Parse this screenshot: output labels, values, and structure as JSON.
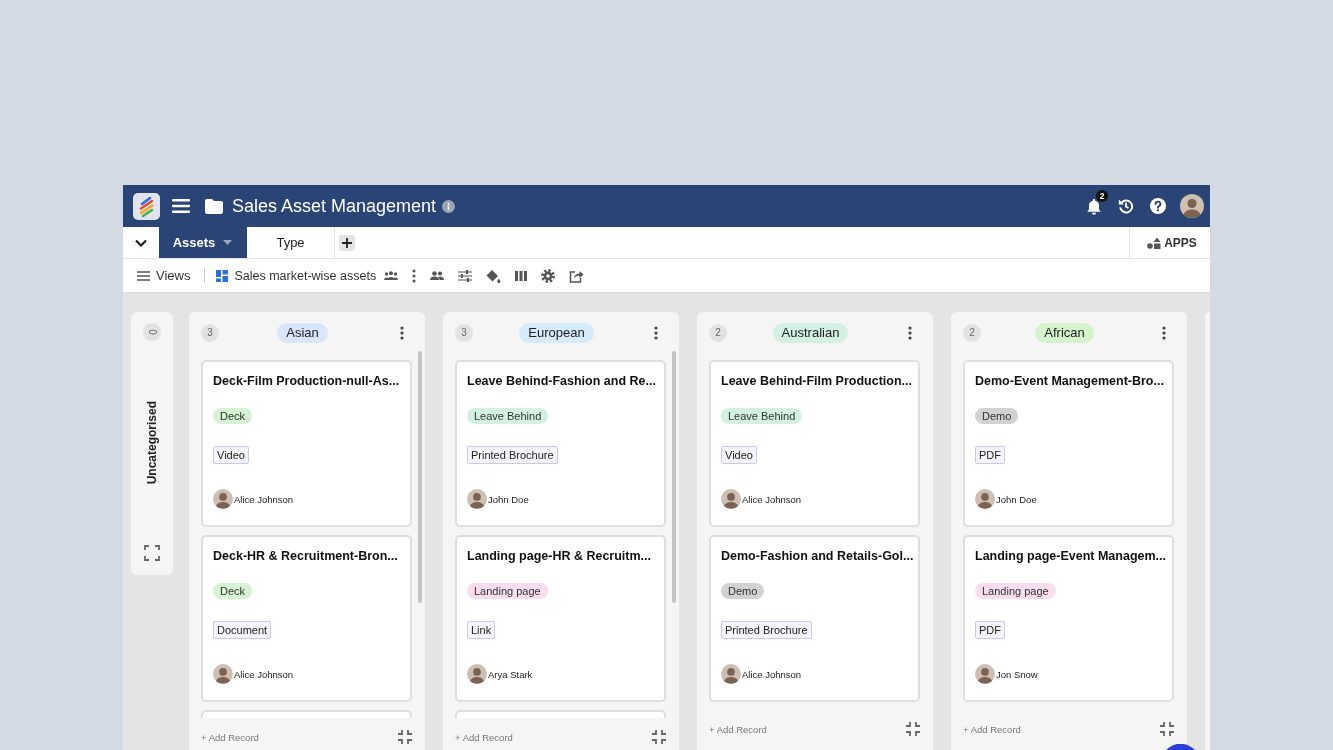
{
  "header": {
    "title": "Sales Asset Management",
    "notifications": "2"
  },
  "tabs": [
    {
      "label": "Assets",
      "selected": true
    },
    {
      "label": "Type",
      "selected": false
    }
  ],
  "apps_label": "APPS",
  "toolbar": {
    "views_label": "Views",
    "view_name": "Sales market-wise assets"
  },
  "board": {
    "uncategorised": {
      "label": "Uncategorised",
      "count": "0"
    },
    "columns": [
      {
        "kind": "group",
        "label": "Asian",
        "count": "3",
        "color": "#d9e5fb",
        "add_label": "+ Add Record",
        "cards": [
          {
            "kind": "record",
            "title": "Deck-Film Production-null-As...",
            "category": {
              "label": "Deck",
              "color": "#d5f2d3"
            },
            "type": "Video",
            "owner": "Alice Johnson"
          },
          {
            "kind": "record",
            "title": "Deck-HR & Recruitment-Bron...",
            "category": {
              "label": "Deck",
              "color": "#d5f2d3"
            },
            "type": "Document",
            "owner": "Alice Johnson"
          },
          {
            "kind": "clipped"
          }
        ]
      },
      {
        "kind": "group",
        "label": "European",
        "count": "3",
        "color": "#d6ebf9",
        "add_label": "+ Add Record",
        "cards": [
          {
            "kind": "record",
            "title": "Leave Behind-Fashion and Re...",
            "category": {
              "label": "Leave Behind",
              "color": "#d3f1e1"
            },
            "type": "Printed Brochure",
            "owner": "John Doe"
          },
          {
            "kind": "record",
            "title": "Landing page-HR & Recruitm...",
            "category": {
              "label": "Landing page",
              "color": "#fadcef"
            },
            "type": "Link",
            "owner": "Arya Stark"
          },
          {
            "kind": "clipped"
          }
        ]
      },
      {
        "kind": "group",
        "label": "Australian",
        "count": "2",
        "color": "#d2f1e3",
        "add_label": "+ Add Record",
        "cards": [
          {
            "kind": "record",
            "title": "Leave Behind-Film Production...",
            "category": {
              "label": "Leave Behind",
              "color": "#d3f1e1"
            },
            "type": "Video",
            "owner": "Alice Johnson"
          },
          {
            "kind": "record",
            "title": "Demo-Fashion and Retails-Gol...",
            "category": {
              "label": "Demo",
              "color": "#d2d2d2"
            },
            "type": "Printed Brochure",
            "owner": "Alice Johnson"
          }
        ]
      },
      {
        "kind": "group",
        "label": "African",
        "count": "2",
        "color": "#d5f4cd",
        "add_label": "+ Add Record",
        "cards": [
          {
            "kind": "record",
            "title": "Demo-Event Management-Bro...",
            "category": {
              "label": "Demo",
              "color": "#d2d2d2"
            },
            "type": "PDF",
            "owner": "John Doe"
          },
          {
            "kind": "record",
            "title": "Landing page-Event Managem...",
            "category": {
              "label": "Landing page",
              "color": "#fadcef"
            },
            "type": "PDF",
            "owner": "Jon Snow"
          }
        ]
      },
      {
        "kind": "clipped"
      }
    ]
  }
}
